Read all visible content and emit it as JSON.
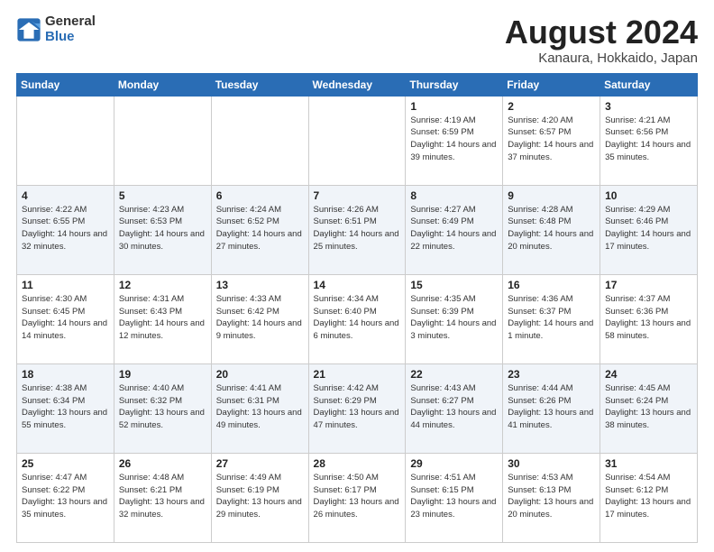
{
  "logo": {
    "general": "General",
    "blue": "Blue"
  },
  "title": "August 2024",
  "location": "Kanaura, Hokkaido, Japan",
  "days_of_week": [
    "Sunday",
    "Monday",
    "Tuesday",
    "Wednesday",
    "Thursday",
    "Friday",
    "Saturday"
  ],
  "weeks": [
    [
      {
        "day": "",
        "info": ""
      },
      {
        "day": "",
        "info": ""
      },
      {
        "day": "",
        "info": ""
      },
      {
        "day": "",
        "info": ""
      },
      {
        "day": "1",
        "info": "Sunrise: 4:19 AM\nSunset: 6:59 PM\nDaylight: 14 hours\nand 39 minutes."
      },
      {
        "day": "2",
        "info": "Sunrise: 4:20 AM\nSunset: 6:57 PM\nDaylight: 14 hours\nand 37 minutes."
      },
      {
        "day": "3",
        "info": "Sunrise: 4:21 AM\nSunset: 6:56 PM\nDaylight: 14 hours\nand 35 minutes."
      }
    ],
    [
      {
        "day": "4",
        "info": "Sunrise: 4:22 AM\nSunset: 6:55 PM\nDaylight: 14 hours\nand 32 minutes."
      },
      {
        "day": "5",
        "info": "Sunrise: 4:23 AM\nSunset: 6:53 PM\nDaylight: 14 hours\nand 30 minutes."
      },
      {
        "day": "6",
        "info": "Sunrise: 4:24 AM\nSunset: 6:52 PM\nDaylight: 14 hours\nand 27 minutes."
      },
      {
        "day": "7",
        "info": "Sunrise: 4:26 AM\nSunset: 6:51 PM\nDaylight: 14 hours\nand 25 minutes."
      },
      {
        "day": "8",
        "info": "Sunrise: 4:27 AM\nSunset: 6:49 PM\nDaylight: 14 hours\nand 22 minutes."
      },
      {
        "day": "9",
        "info": "Sunrise: 4:28 AM\nSunset: 6:48 PM\nDaylight: 14 hours\nand 20 minutes."
      },
      {
        "day": "10",
        "info": "Sunrise: 4:29 AM\nSunset: 6:46 PM\nDaylight: 14 hours\nand 17 minutes."
      }
    ],
    [
      {
        "day": "11",
        "info": "Sunrise: 4:30 AM\nSunset: 6:45 PM\nDaylight: 14 hours\nand 14 minutes."
      },
      {
        "day": "12",
        "info": "Sunrise: 4:31 AM\nSunset: 6:43 PM\nDaylight: 14 hours\nand 12 minutes."
      },
      {
        "day": "13",
        "info": "Sunrise: 4:33 AM\nSunset: 6:42 PM\nDaylight: 14 hours\nand 9 minutes."
      },
      {
        "day": "14",
        "info": "Sunrise: 4:34 AM\nSunset: 6:40 PM\nDaylight: 14 hours\nand 6 minutes."
      },
      {
        "day": "15",
        "info": "Sunrise: 4:35 AM\nSunset: 6:39 PM\nDaylight: 14 hours\nand 3 minutes."
      },
      {
        "day": "16",
        "info": "Sunrise: 4:36 AM\nSunset: 6:37 PM\nDaylight: 14 hours\nand 1 minute."
      },
      {
        "day": "17",
        "info": "Sunrise: 4:37 AM\nSunset: 6:36 PM\nDaylight: 13 hours\nand 58 minutes."
      }
    ],
    [
      {
        "day": "18",
        "info": "Sunrise: 4:38 AM\nSunset: 6:34 PM\nDaylight: 13 hours\nand 55 minutes."
      },
      {
        "day": "19",
        "info": "Sunrise: 4:40 AM\nSunset: 6:32 PM\nDaylight: 13 hours\nand 52 minutes."
      },
      {
        "day": "20",
        "info": "Sunrise: 4:41 AM\nSunset: 6:31 PM\nDaylight: 13 hours\nand 49 minutes."
      },
      {
        "day": "21",
        "info": "Sunrise: 4:42 AM\nSunset: 6:29 PM\nDaylight: 13 hours\nand 47 minutes."
      },
      {
        "day": "22",
        "info": "Sunrise: 4:43 AM\nSunset: 6:27 PM\nDaylight: 13 hours\nand 44 minutes."
      },
      {
        "day": "23",
        "info": "Sunrise: 4:44 AM\nSunset: 6:26 PM\nDaylight: 13 hours\nand 41 minutes."
      },
      {
        "day": "24",
        "info": "Sunrise: 4:45 AM\nSunset: 6:24 PM\nDaylight: 13 hours\nand 38 minutes."
      }
    ],
    [
      {
        "day": "25",
        "info": "Sunrise: 4:47 AM\nSunset: 6:22 PM\nDaylight: 13 hours\nand 35 minutes."
      },
      {
        "day": "26",
        "info": "Sunrise: 4:48 AM\nSunset: 6:21 PM\nDaylight: 13 hours\nand 32 minutes."
      },
      {
        "day": "27",
        "info": "Sunrise: 4:49 AM\nSunset: 6:19 PM\nDaylight: 13 hours\nand 29 minutes."
      },
      {
        "day": "28",
        "info": "Sunrise: 4:50 AM\nSunset: 6:17 PM\nDaylight: 13 hours\nand 26 minutes."
      },
      {
        "day": "29",
        "info": "Sunrise: 4:51 AM\nSunset: 6:15 PM\nDaylight: 13 hours\nand 23 minutes."
      },
      {
        "day": "30",
        "info": "Sunrise: 4:53 AM\nSunset: 6:13 PM\nDaylight: 13 hours\nand 20 minutes."
      },
      {
        "day": "31",
        "info": "Sunrise: 4:54 AM\nSunset: 6:12 PM\nDaylight: 13 hours\nand 17 minutes."
      }
    ]
  ]
}
